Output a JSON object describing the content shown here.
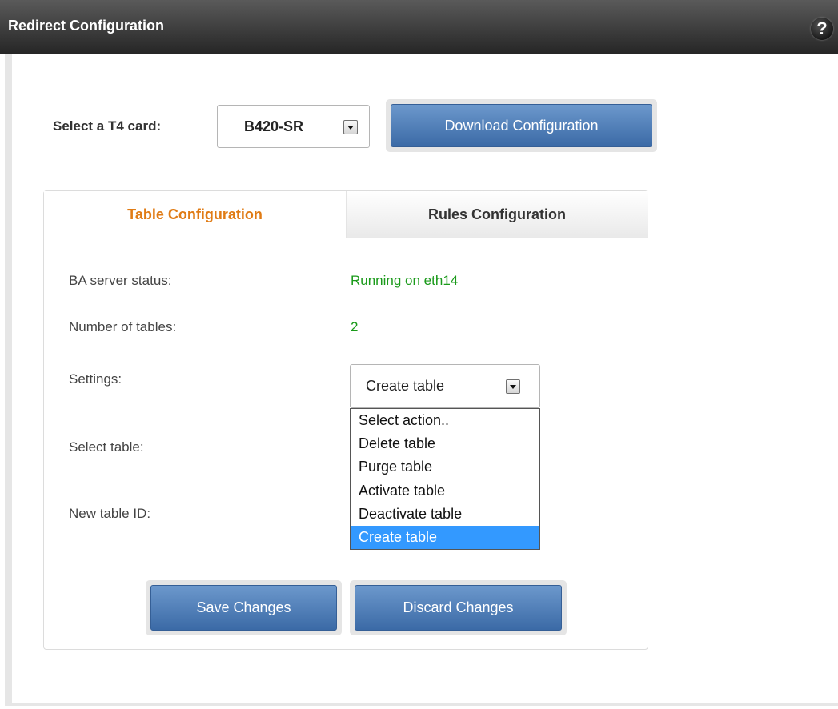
{
  "header": {
    "title": "Redirect Configuration",
    "help_symbol": "?"
  },
  "card_selector": {
    "label": "Select a T4 card:",
    "value": "B420-SR"
  },
  "download_button": "Download Configuration",
  "tabs": [
    {
      "label": "Table Configuration",
      "active": true
    },
    {
      "label": "Rules Configuration",
      "active": false
    }
  ],
  "fields": {
    "ba_status_label": "BA server status:",
    "ba_status_value": "Running on eth14",
    "num_tables_label": "Number of tables:",
    "num_tables_value": "2",
    "settings_label": "Settings:",
    "settings_value": "Create table",
    "select_table_label": "Select table:",
    "new_table_id_label": "New table ID:"
  },
  "settings_options": [
    "Select action..",
    "Delete table",
    "Purge table",
    "Activate table",
    "Deactivate table",
    "Create table"
  ],
  "buttons": {
    "save": "Save Changes",
    "discard": "Discard Changes"
  },
  "colors": {
    "accent_tab": "#e07b14",
    "status_green": "#1a9a1a",
    "button_blue": "#4a7cba",
    "selection_blue": "#3399ff"
  }
}
